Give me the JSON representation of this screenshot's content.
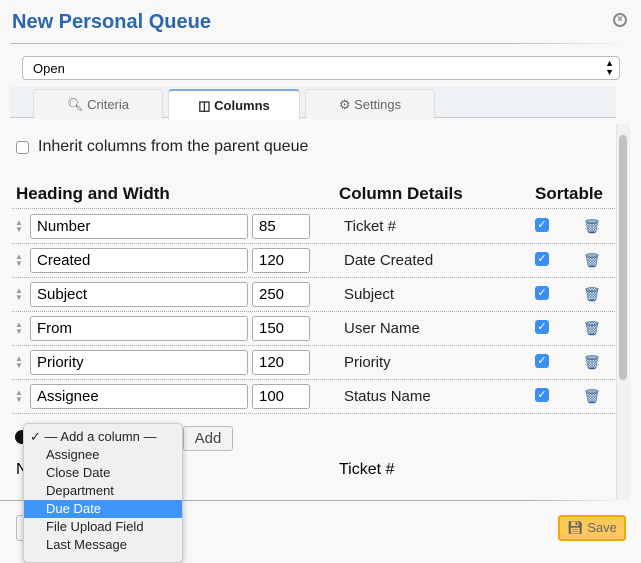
{
  "title": "New Personal Queue",
  "queue_select": {
    "value": "Open"
  },
  "tabs": [
    {
      "label": "Criteria",
      "icon": "search-icon"
    },
    {
      "label": "Columns",
      "icon": "columns-icon",
      "active": true
    },
    {
      "label": "Settings",
      "icon": "gear-icon"
    }
  ],
  "inherit_label": "Inherit columns from the parent queue",
  "inherit_checked": false,
  "headers": {
    "heading": "Heading and Width",
    "details": "Column Details",
    "sortable": "Sortable"
  },
  "rows": [
    {
      "heading": "Number",
      "width": "85",
      "details": "Ticket #",
      "sortable": true
    },
    {
      "heading": "Created",
      "width": "120",
      "details": "Date Created",
      "sortable": true
    },
    {
      "heading": "Subject",
      "width": "250",
      "details": "Subject",
      "sortable": true
    },
    {
      "heading": "From",
      "width": "150",
      "details": "User Name",
      "sortable": true
    },
    {
      "heading": "Priority",
      "width": "120",
      "details": "Priority",
      "sortable": true
    },
    {
      "heading": "Assignee",
      "width": "100",
      "details": "Status Name",
      "sortable": true
    }
  ],
  "add_column": {
    "button": "Add",
    "options": [
      "— Add a column —",
      "Assignee",
      "Close Date",
      "Department",
      "Due Date",
      "File Upload Field",
      "Last Message"
    ],
    "selected": "— Add a column —",
    "highlighted": "Due Date"
  },
  "partial_row": {
    "heading": "N",
    "details": "Ticket #"
  },
  "save_label": "Save",
  "colors": {
    "title": "#2a67ac",
    "checkbox": "#3a8ff0",
    "save": "#fcc85a",
    "highlight": "#3d95f7"
  }
}
